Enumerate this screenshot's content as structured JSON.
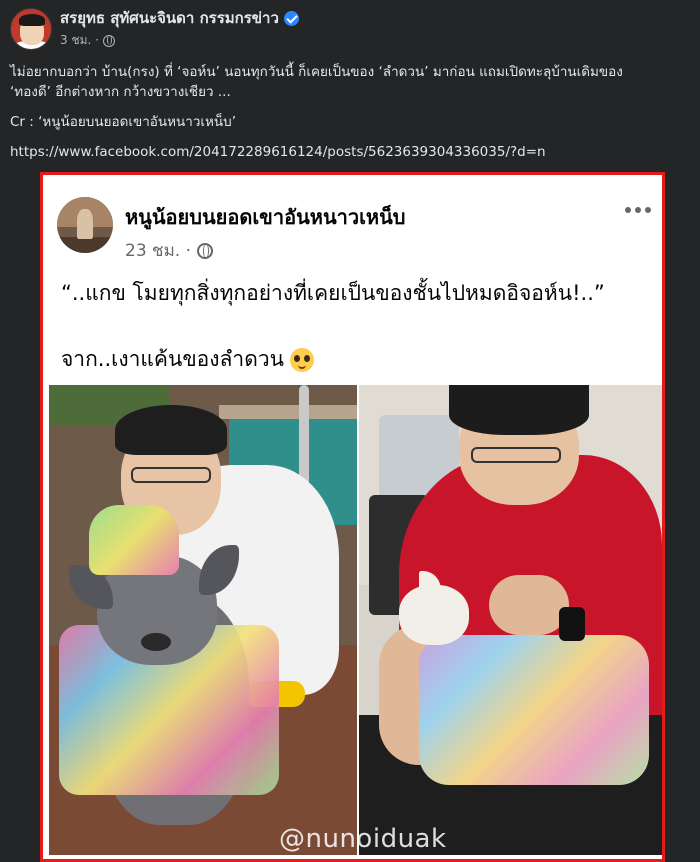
{
  "post": {
    "author": "สรยุทธ สุทัศนะจินดา กรรมกรข่าว",
    "time": "3 ชม. ·",
    "text_line1": "ไม่อยากบอกว่า บ้าน(กรง) ที่ ‘จอห์น’ นอนทุกวันนี้ ก็เคยเป็นของ ‘ลำดวน’ มาก่อน แถมเปิดทะลุบ้านเดิมของ",
    "text_line2": "‘ทองดี’ อีกต่างหาก กว้างขวางเชียว ...",
    "credit": "Cr : ‘หนูน้อยบนยอดเขาอันหนาวเหน็บ’",
    "link": "https://www.facebook.com/204172289616124/posts/5623639304336035/?d=n",
    "icons": {
      "verified": "verified-badge-icon",
      "globe": "globe-icon"
    },
    "colors": {
      "background": "#242526",
      "text": "#e4e6eb",
      "verified": "#2d88ff"
    }
  },
  "embedded": {
    "author": "หนูน้อยบนยอดเขาอันหนาวเหน็บ",
    "time": "23 ชม. ·",
    "quote": "“..แกข โมยทุกสิ่งทุกอย่างที่เคยเป็นของชั้นไปหมดอิจอห์น!..”",
    "from_text": "จาก..เงาแค้นของลำดวน",
    "watermark": "@nunoiduak",
    "icons": {
      "more": "more-options-icon",
      "emoji": "pleading-face-icon",
      "globe": "globe-icon"
    },
    "colors": {
      "border": "#e31b1b",
      "card": "#ffffff"
    }
  }
}
